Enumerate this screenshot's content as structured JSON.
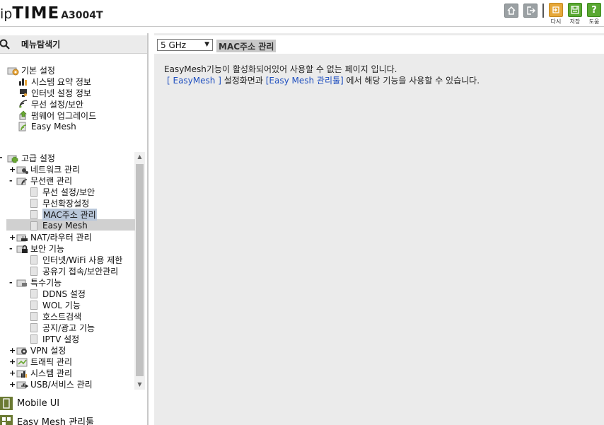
{
  "header": {
    "logo_ip": "ip",
    "logo_time": "TIME",
    "model": "A3004T",
    "buttons": [
      {
        "label": "다시",
        "icon": "reload-icon",
        "color": "#e6a83a"
      },
      {
        "label": "저장",
        "icon": "save-icon",
        "color": "#5aa832"
      },
      {
        "label": "도움",
        "icon": "help-icon",
        "color": "#5aa832"
      }
    ],
    "home_icon": "home-icon",
    "logout_icon": "logout-icon"
  },
  "sidebar": {
    "title": "메뉴탐색기",
    "basic_group": {
      "label": "기본 설정",
      "items": [
        "시스템 요약 정보",
        "인터넷 설정 정보",
        "무선 설정/보안",
        "펌웨어 업그레이드",
        "Easy Mesh"
      ]
    },
    "advanced_group": {
      "label": "고급 설정",
      "items": [
        {
          "label": "네트워크 관리",
          "expander": "+"
        },
        {
          "label": "무선랜 관리",
          "expander": "-",
          "children": [
            "무선 설정/보안",
            "무선확장설정",
            "MAC주소 관리",
            "Easy Mesh"
          ]
        },
        {
          "label": "NAT/라우터 관리",
          "expander": "+"
        },
        {
          "label": "보안 기능",
          "expander": "-",
          "children": [
            "인터넷/WiFi 사용 제한",
            "공유기 접속/보안관리"
          ]
        },
        {
          "label": "특수기능",
          "expander": "-",
          "children": [
            "DDNS 설정",
            "WOL 기능",
            "호스트검색",
            "공지/광고 기능",
            "IPTV 설정"
          ]
        },
        {
          "label": "VPN 설정",
          "expander": "+"
        },
        {
          "label": "트래픽 관리",
          "expander": "+"
        },
        {
          "label": "시스템 관리",
          "expander": "+"
        },
        {
          "label": "USB/서비스 관리",
          "expander": "+"
        }
      ]
    },
    "bottom_links": [
      "Mobile UI",
      "Easy Mesh 관리툴"
    ]
  },
  "main": {
    "band_select": {
      "value": "5 GHz"
    },
    "page_title": "MAC주소 관리",
    "message_line1": "EasyMesh기능이 활성화되어있어 사용할 수 없는 페이지 입니다.",
    "link1": "[ EasyMesh ]",
    "message_mid": " 설정화면과 ",
    "link2": "[Easy Mesh 관리툴]",
    "message_end": " 에서 해당 기능을 사용할 수 있습니다."
  }
}
